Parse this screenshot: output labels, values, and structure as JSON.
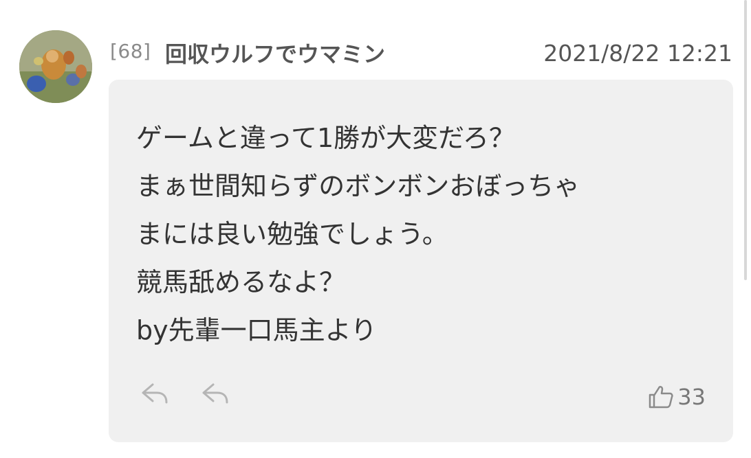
{
  "post": {
    "number": "[68]",
    "author": "回収ウルフでウマミン",
    "timestamp": "2021/8/22 12:21",
    "lines": [
      "ゲームと違って1勝が大変だろ？",
      "まぁ世間知らずのボンボンおぼっちゃ",
      "まには良い勉強でしょう。",
      "競馬舐めるなよ？",
      "by先輩一口馬主より"
    ],
    "likes": "33"
  },
  "icons": {
    "avatar": "avatar-image",
    "reply": "reply-arrow-icon",
    "like": "thumbs-up-icon"
  },
  "colors": {
    "bubble_background": "#f0f0f0",
    "text": "#333333",
    "meta_text": "#555555"
  }
}
